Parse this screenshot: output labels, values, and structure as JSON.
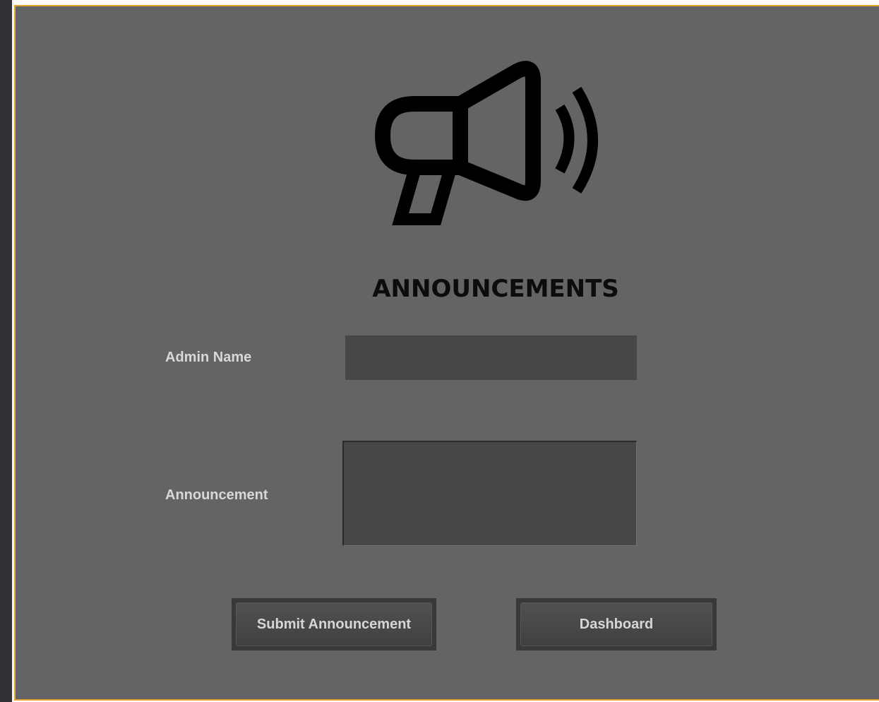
{
  "header": {
    "icon": "megaphone-icon",
    "title": "ANNOUNCEMENTS"
  },
  "form": {
    "admin_label": "Admin Name",
    "admin_value": "",
    "announcement_label": "Announcement",
    "announcement_value": ""
  },
  "buttons": {
    "submit_label": "Submit Announcement",
    "dashboard_label": "Dashboard"
  },
  "colors": {
    "panel_bg": "#636466",
    "accent_border": "#e8a22d",
    "field_bg": "#454748",
    "label_text": "#d8d8d8"
  }
}
